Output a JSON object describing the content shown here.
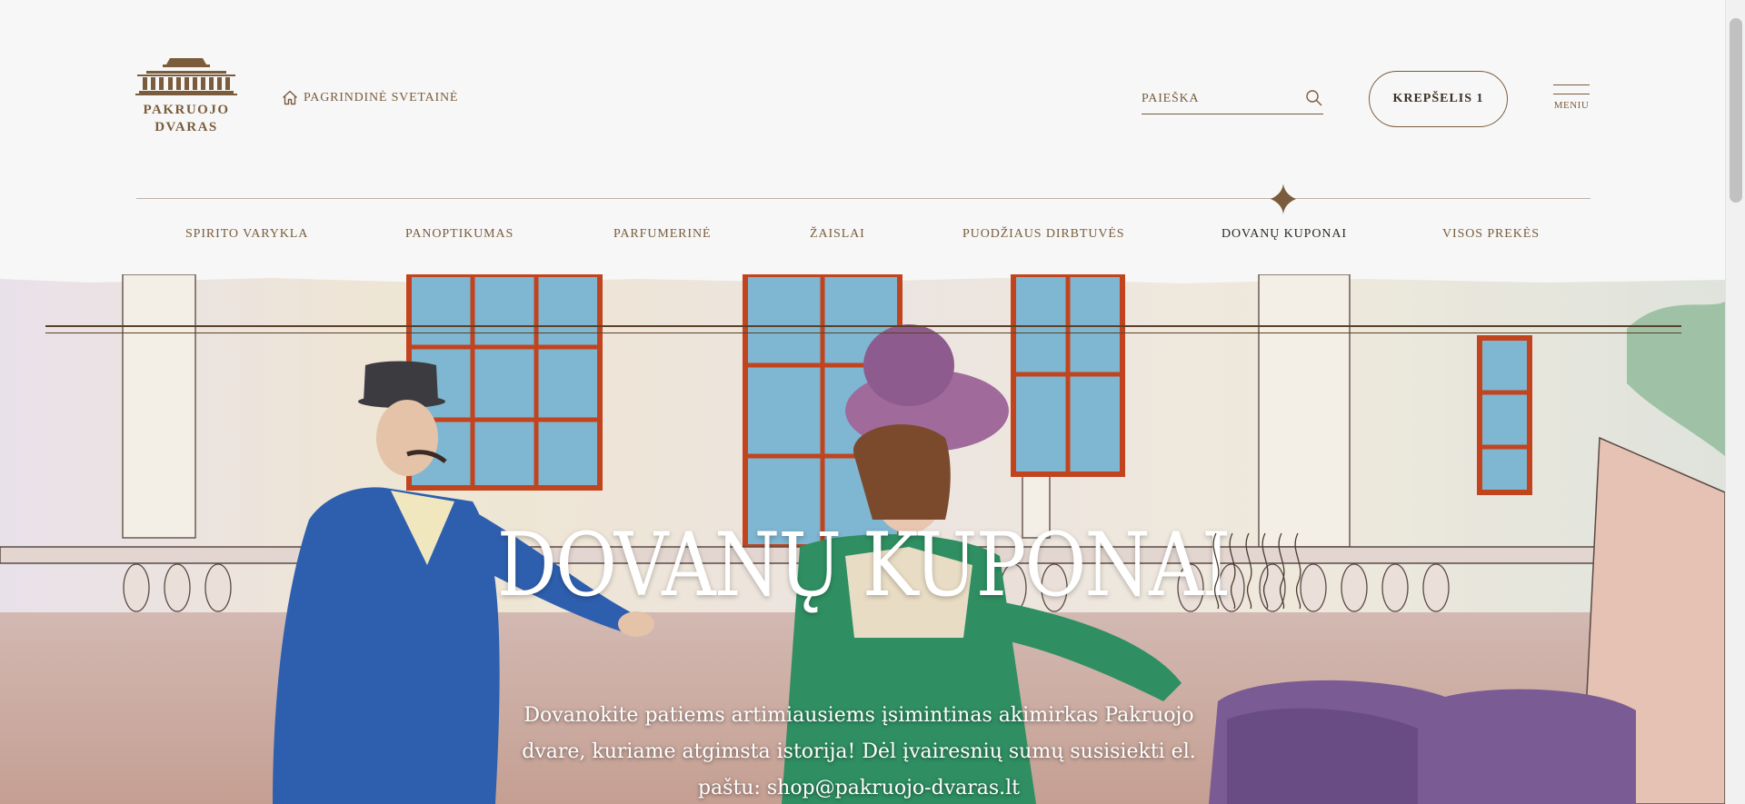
{
  "header": {
    "logo_line1": "PAKRUOJO",
    "logo_line2": "DVARAS",
    "home_link": "PAGRINDINĖ SVETAINĖ",
    "search_placeholder": "PAIEŠKA",
    "cart_label": "KREPŠELIS 1",
    "menu_label": "MENIU"
  },
  "nav": {
    "items": [
      {
        "label": "SPIRITO VARYKLA"
      },
      {
        "label": "PANOPTIKUMAS"
      },
      {
        "label": "PARFUMERINĖ"
      },
      {
        "label": "ŽAISLAI"
      },
      {
        "label": "PUODŽIAUS DIRBTUVĖS"
      },
      {
        "label": "DOVANŲ KUPONAI",
        "active": true
      },
      {
        "label": "VISOS PREKĖS"
      }
    ]
  },
  "hero": {
    "title": "DOVANŲ KUPONAI",
    "description": "Dovanokite patiems artimiausiems įsimintinas akimirkas Pakruojo dvare, kuriame atgimsta istorija! Dėl įvairesnių sumų susisiekti el. paštu: shop@pakruojo-dvaras.lt"
  },
  "colors": {
    "brand": "#7a5c3c",
    "background": "#f7f7f7",
    "nav_active": "#2f2a24"
  },
  "icons": [
    "manor-logo-icon",
    "home-icon",
    "search-icon",
    "hamburger-icon",
    "nav-diamond-icon"
  ]
}
